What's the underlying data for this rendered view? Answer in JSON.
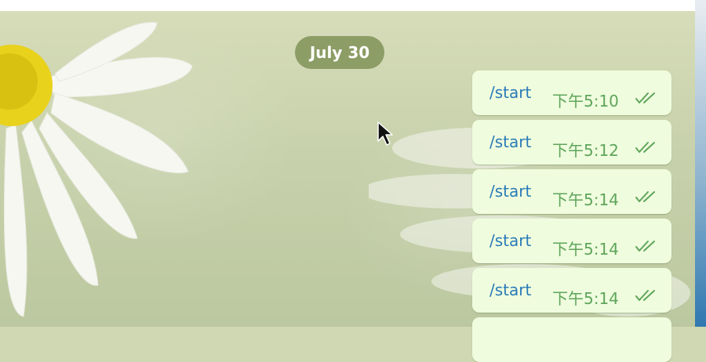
{
  "chat": {
    "date_separator": "July 30",
    "messages": [
      {
        "text": "/start",
        "time": "下午5:10"
      },
      {
        "text": "/start",
        "time": "下午5:12"
      },
      {
        "text": "/start",
        "time": "下午5:14"
      },
      {
        "text": "/start",
        "time": "下午5:14"
      },
      {
        "text": "/start",
        "time": "下午5:14"
      },
      {
        "text": "",
        "time": ""
      }
    ]
  },
  "icons": {
    "read_status": "double-check-icon",
    "pointer": "mouse-cursor-icon"
  },
  "colors": {
    "bubble": "#effdde",
    "command_link": "#2a7ab8",
    "timestamp": "#5fa55b",
    "date_pill": "#7d9250"
  }
}
